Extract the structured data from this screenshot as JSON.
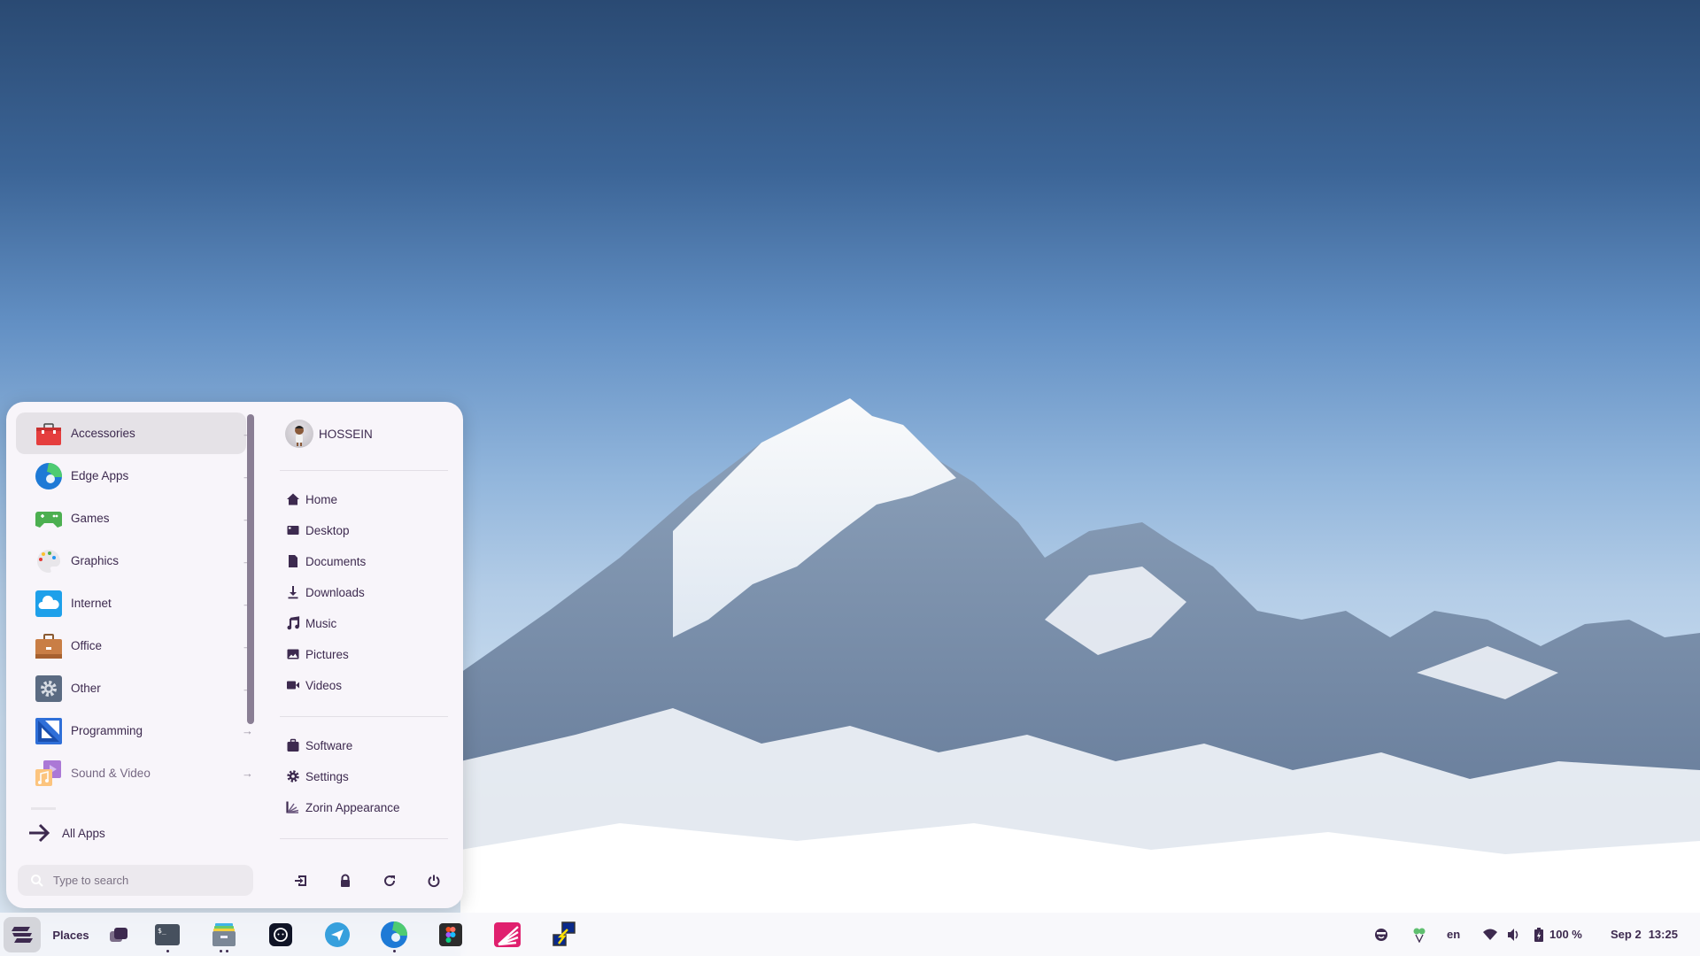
{
  "menu": {
    "categories": [
      {
        "label": "Accessories",
        "icon": "toolbox-icon",
        "active": true
      },
      {
        "label": "Edge Apps",
        "icon": "edge-icon"
      },
      {
        "label": "Games",
        "icon": "gamepad-icon"
      },
      {
        "label": "Graphics",
        "icon": "palette-icon"
      },
      {
        "label": "Internet",
        "icon": "cloud-icon"
      },
      {
        "label": "Office",
        "icon": "briefcase-icon"
      },
      {
        "label": "Other",
        "icon": "gear-icon"
      },
      {
        "label": "Programming",
        "icon": "set-square-icon"
      },
      {
        "label": "Sound & Video",
        "icon": "music-video-icon"
      }
    ],
    "arrow_glyph": "→",
    "all_apps_label": "All Apps",
    "search_placeholder": "Type to search",
    "user": {
      "name": "HOSSEIN"
    },
    "places": [
      {
        "label": "Home",
        "icon": "home-icon"
      },
      {
        "label": "Desktop",
        "icon": "desktop-icon"
      },
      {
        "label": "Documents",
        "icon": "document-icon"
      },
      {
        "label": "Downloads",
        "icon": "download-icon"
      },
      {
        "label": "Music",
        "icon": "music-icon"
      },
      {
        "label": "Pictures",
        "icon": "picture-icon"
      },
      {
        "label": "Videos",
        "icon": "video-icon"
      }
    ],
    "system": [
      {
        "label": "Software",
        "icon": "software-bag-icon"
      },
      {
        "label": "Settings",
        "icon": "settings-gear-icon"
      },
      {
        "label": "Zorin Appearance",
        "icon": "appearance-icon"
      }
    ],
    "power_buttons": [
      "log-out",
      "lock",
      "restart",
      "power-off"
    ]
  },
  "taskbar": {
    "places_label": "Places",
    "apps": [
      "Workspaces",
      "Terminal",
      "Files",
      "ChatGPT",
      "Telegram",
      "Microsoft Edge",
      "Figma",
      "Zorin Appearance",
      "Remote Desktop"
    ],
    "tray": {
      "language": "en",
      "battery": "100 %",
      "date": "Sep 2",
      "time": "13:25"
    }
  },
  "colors": {
    "menu_bg": "#f8f5fa",
    "accent": "#3d2a4f",
    "highlight": "#e5e2e7"
  }
}
